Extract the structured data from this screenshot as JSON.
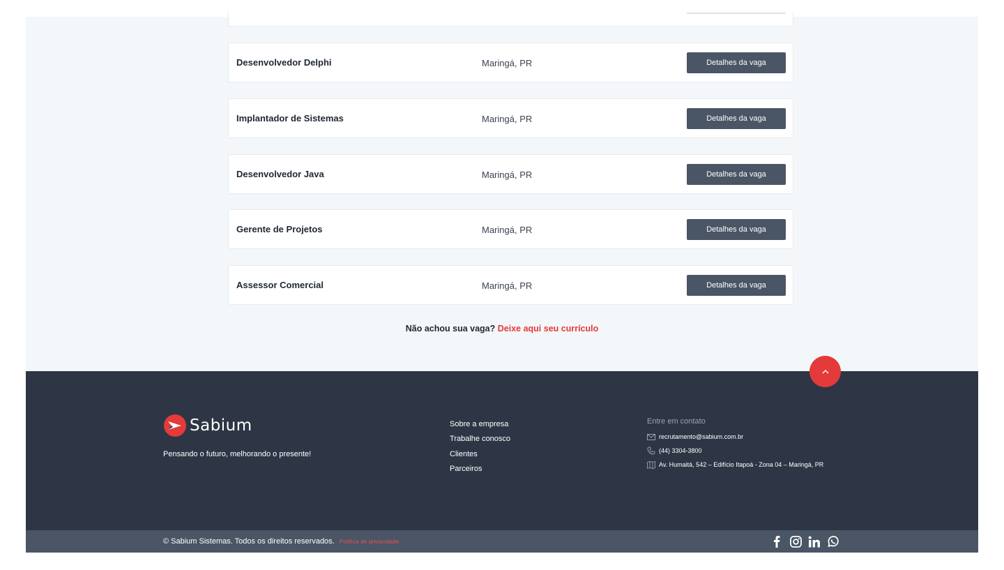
{
  "jobs": [
    {
      "title": "Desenvolvedor Delphi",
      "location": "Maringá, PR",
      "button": "Detalhes da vaga"
    },
    {
      "title": "Implantador de Sistemas",
      "location": "Maringá, PR",
      "button": "Detalhes da vaga"
    },
    {
      "title": "Desenvolvedor Java",
      "location": "Maringá, PR",
      "button": "Detalhes da vaga"
    },
    {
      "title": "Gerente de Projetos",
      "location": "Maringá, PR",
      "button": "Detalhes da vaga"
    },
    {
      "title": "Assessor Comercial",
      "location": "Maringá, PR",
      "button": "Detalhes da vaga"
    }
  ],
  "cta": {
    "text": "Não achou sua vaga?",
    "link": "Deixe aqui seu currículo"
  },
  "footer": {
    "brand": "Sabium",
    "tagline": "Pensando o futuro, melhorando o presente!",
    "links": [
      "Sobre a empresa",
      "Trabalhe conosco",
      "Clientes",
      "Parceiros"
    ],
    "contact": {
      "title": "Entre em contato",
      "email": "recrutamento@sabium.com.br",
      "phone": "(44) 3304-3800",
      "address": "Av. Humaitá, 542 – Edifício Itapoá - Zona 04 – Maringá, PR"
    },
    "copyright": "© Sabium Sistemas. Todos os direitos reservados.",
    "privacy": "Política de privacidade",
    "socials": [
      "facebook-icon",
      "instagram-icon",
      "linkedin-icon",
      "whatsapp-icon"
    ]
  },
  "colors": {
    "accent": "#e43a3a",
    "footer_bg": "#2e3645",
    "bottom_bar": "#4a5566",
    "button": "#4a5566"
  }
}
